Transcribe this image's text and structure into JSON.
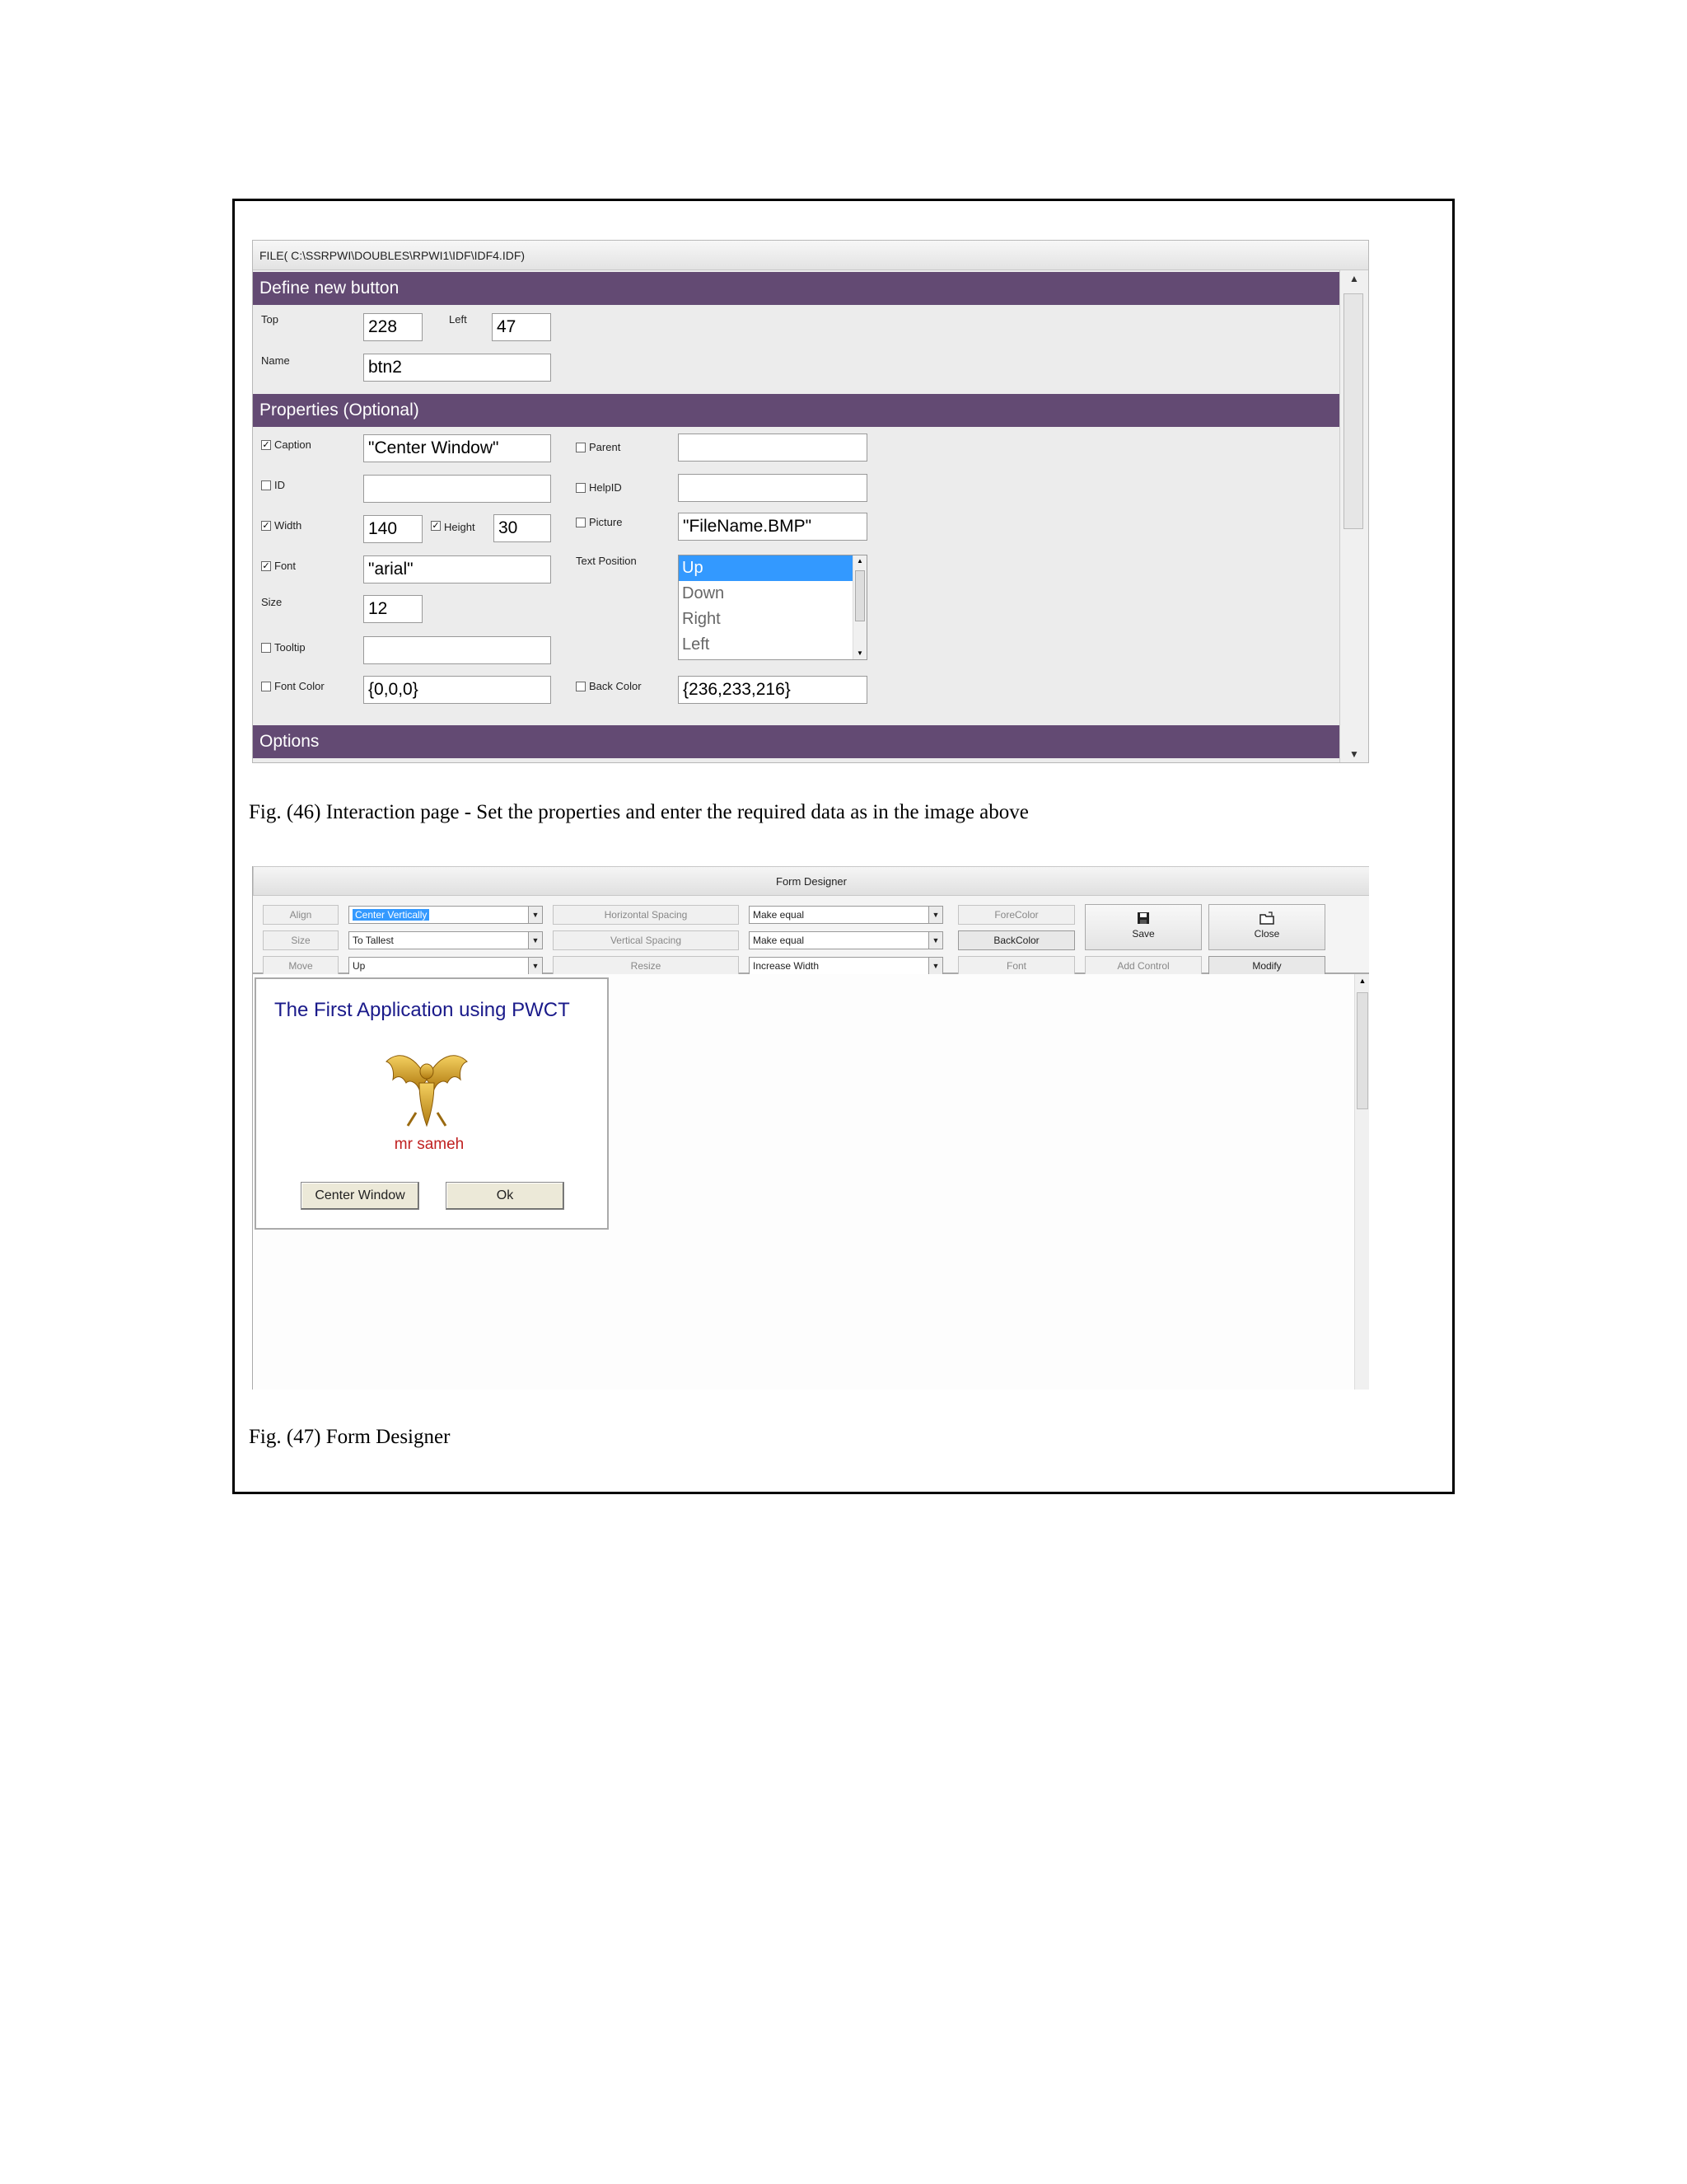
{
  "fig46": {
    "file_path": "FILE( C:\\SSRPWI\\DOUBLES\\RPWI1\\IDF\\IDF4.IDF)",
    "sections": {
      "define": "Define new button",
      "properties": "Properties (Optional)",
      "options": "Options"
    },
    "define": {
      "top_label": "Top",
      "top_value": "228",
      "left_label": "Left",
      "left_value": "47",
      "name_label": "Name",
      "name_value": "btn2"
    },
    "props": {
      "caption_label": "Caption",
      "caption_value": "\"Center Window\"",
      "id_label": "ID",
      "id_value": "",
      "width_label": "Width",
      "width_value": "140",
      "height_label": "Height",
      "height_value": "30",
      "font_label": "Font",
      "font_value": "\"arial\"",
      "size_label": "Size",
      "size_value": "12",
      "tooltip_label": "Tooltip",
      "tooltip_value": "",
      "fontcolor_label": "Font Color",
      "fontcolor_value": "{0,0,0}",
      "parent_label": "Parent",
      "parent_value": "",
      "helpid_label": "HelpID",
      "helpid_value": "",
      "picture_label": "Picture",
      "picture_value": "\"FileName.BMP\"",
      "textpos_label": "Text Position",
      "textpos_options": [
        "Up",
        "Down",
        "Right",
        "Left"
      ],
      "backcolor_label": "Back Color",
      "backcolor_value": "{236,233,216}"
    },
    "caption": "Fig. (46) Interaction page - Set the properties and enter the required data as in the image above"
  },
  "fig47": {
    "title": "Form Designer",
    "buttons": {
      "align": "Align",
      "size": "Size",
      "move": "Move",
      "hspacing": "Horizontal Spacing",
      "vspacing": "Vertical Spacing",
      "resize": "Resize",
      "forecolor": "ForeColor",
      "backcolor": "BackColor",
      "font": "Font",
      "addcontrol": "Add Control",
      "modify": "Modify",
      "save": "Save",
      "close": "Close"
    },
    "combos": {
      "align": "Center Vertically",
      "size": "To Tallest",
      "move": "Up",
      "hspacing": "Make equal",
      "vspacing": "Make equal",
      "resize": "Increase Width"
    },
    "form": {
      "title": "The First Application using PWCT",
      "author": "mr sameh",
      "btn_center": "Center Window",
      "btn_ok": "Ok"
    },
    "caption": "Fig. (47) Form Designer"
  },
  "icons": {
    "save": "floppy-disk",
    "close": "folder",
    "eagle": "golden-eagle-logo"
  },
  "colors": {
    "section_header": "#634a73",
    "selection": "#3399ff",
    "form_title": "#1a1a8a",
    "author": "#c02020"
  }
}
